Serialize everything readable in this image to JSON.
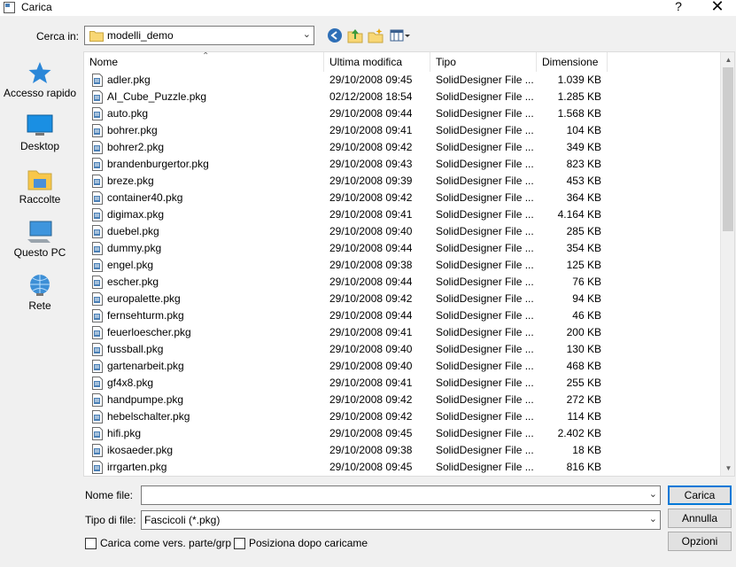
{
  "window": {
    "title": "Carica",
    "help": "?",
    "close": "✕"
  },
  "lookin": {
    "label": "Cerca in:",
    "value": "modelli_demo"
  },
  "places": [
    {
      "label": "Accesso rapido",
      "icon": "star-icon"
    },
    {
      "label": "Desktop",
      "icon": "desktop-icon"
    },
    {
      "label": "Raccolte",
      "icon": "libraries-icon"
    },
    {
      "label": "Questo PC",
      "icon": "computer-icon"
    },
    {
      "label": "Rete",
      "icon": "network-icon"
    }
  ],
  "columns": {
    "name": "Nome",
    "modified": "Ultima modifica",
    "type": "Tipo",
    "size": "Dimensione"
  },
  "files": [
    {
      "name": "adler.pkg",
      "modified": "29/10/2008 09:45",
      "type": "SolidDesigner File ...",
      "size": "1.039 KB"
    },
    {
      "name": "AI_Cube_Puzzle.pkg",
      "modified": "02/12/2008 18:54",
      "type": "SolidDesigner File ...",
      "size": "1.285 KB"
    },
    {
      "name": "auto.pkg",
      "modified": "29/10/2008 09:44",
      "type": "SolidDesigner File ...",
      "size": "1.568 KB"
    },
    {
      "name": "bohrer.pkg",
      "modified": "29/10/2008 09:41",
      "type": "SolidDesigner File ...",
      "size": "104 KB"
    },
    {
      "name": "bohrer2.pkg",
      "modified": "29/10/2008 09:42",
      "type": "SolidDesigner File ...",
      "size": "349 KB"
    },
    {
      "name": "brandenburgertor.pkg",
      "modified": "29/10/2008 09:43",
      "type": "SolidDesigner File ...",
      "size": "823 KB"
    },
    {
      "name": "breze.pkg",
      "modified": "29/10/2008 09:39",
      "type": "SolidDesigner File ...",
      "size": "453 KB"
    },
    {
      "name": "container40.pkg",
      "modified": "29/10/2008 09:42",
      "type": "SolidDesigner File ...",
      "size": "364 KB"
    },
    {
      "name": "digimax.pkg",
      "modified": "29/10/2008 09:41",
      "type": "SolidDesigner File ...",
      "size": "4.164 KB"
    },
    {
      "name": "duebel.pkg",
      "modified": "29/10/2008 09:40",
      "type": "SolidDesigner File ...",
      "size": "285 KB"
    },
    {
      "name": "dummy.pkg",
      "modified": "29/10/2008 09:44",
      "type": "SolidDesigner File ...",
      "size": "354 KB"
    },
    {
      "name": "engel.pkg",
      "modified": "29/10/2008 09:38",
      "type": "SolidDesigner File ...",
      "size": "125 KB"
    },
    {
      "name": "escher.pkg",
      "modified": "29/10/2008 09:44",
      "type": "SolidDesigner File ...",
      "size": "76 KB"
    },
    {
      "name": "europalette.pkg",
      "modified": "29/10/2008 09:42",
      "type": "SolidDesigner File ...",
      "size": "94 KB"
    },
    {
      "name": "fernsehturm.pkg",
      "modified": "29/10/2008 09:44",
      "type": "SolidDesigner File ...",
      "size": "46 KB"
    },
    {
      "name": "feuerloescher.pkg",
      "modified": "29/10/2008 09:41",
      "type": "SolidDesigner File ...",
      "size": "200 KB"
    },
    {
      "name": "fussball.pkg",
      "modified": "29/10/2008 09:40",
      "type": "SolidDesigner File ...",
      "size": "130 KB"
    },
    {
      "name": "gartenarbeit.pkg",
      "modified": "29/10/2008 09:40",
      "type": "SolidDesigner File ...",
      "size": "468 KB"
    },
    {
      "name": "gf4x8.pkg",
      "modified": "29/10/2008 09:41",
      "type": "SolidDesigner File ...",
      "size": "255 KB"
    },
    {
      "name": "handpumpe.pkg",
      "modified": "29/10/2008 09:42",
      "type": "SolidDesigner File ...",
      "size": "272 KB"
    },
    {
      "name": "hebelschalter.pkg",
      "modified": "29/10/2008 09:42",
      "type": "SolidDesigner File ...",
      "size": "114 KB"
    },
    {
      "name": "hifi.pkg",
      "modified": "29/10/2008 09:45",
      "type": "SolidDesigner File ...",
      "size": "2.402 KB"
    },
    {
      "name": "ikosaeder.pkg",
      "modified": "29/10/2008 09:38",
      "type": "SolidDesigner File ...",
      "size": "18 KB"
    },
    {
      "name": "irrgarten.pkg",
      "modified": "29/10/2008 09:45",
      "type": "SolidDesigner File ...",
      "size": "816 KB"
    }
  ],
  "filename": {
    "label": "Nome file:",
    "value": ""
  },
  "filetype": {
    "label": "Tipo di file:",
    "value": "Fascicoli (*.pkg)"
  },
  "buttons": {
    "open": "Carica",
    "cancel": "Annulla",
    "options": "Opzioni"
  },
  "checkboxes": {
    "load_as_part": "Carica come vers. parte/grp",
    "position_after": "Posiziona dopo caricamen"
  },
  "colors": {
    "accent": "#0078d7",
    "folder": "#f8d775",
    "file_icon": "#4a7fb5"
  }
}
